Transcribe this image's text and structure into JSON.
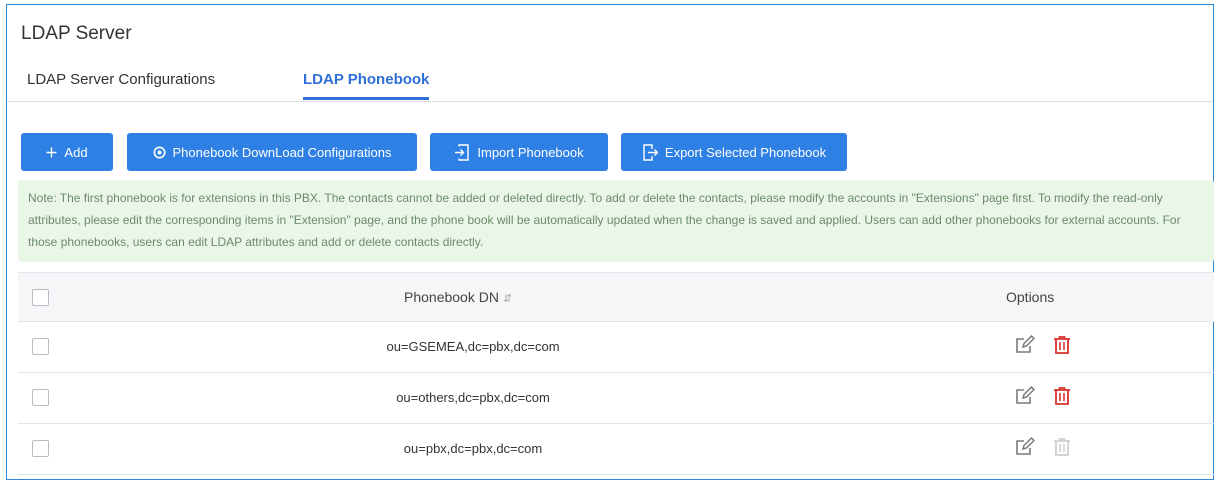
{
  "page": {
    "title": "LDAP Server"
  },
  "tabs": [
    {
      "label": "LDAP Server Configurations",
      "active": false
    },
    {
      "label": "LDAP Phonebook",
      "active": true
    }
  ],
  "toolbar": {
    "add_label": "Add",
    "download_config_label": "Phonebook DownLoad Configurations",
    "import_label": "Import Phonebook",
    "export_label": "Export Selected Phonebook"
  },
  "note": {
    "text": "Note: The first phonebook is for extensions in this PBX. The contacts cannot be added or deleted directly. To add or delete the contacts, please modify the accounts in \"Extensions\" page first. To modify the read-only attributes, please edit the corresponding items in \"Extension\" page, and the phone book will be automatically updated when the change is saved and applied. Users can add other phonebooks for external accounts. For those phonebooks, users can edit LDAP attributes and add or delete contacts directly."
  },
  "table": {
    "columns": {
      "dn": "Phonebook DN",
      "options": "Options"
    },
    "rows": [
      {
        "dn": "ou=GSEMEA,dc=pbx,dc=com",
        "delete_enabled": true
      },
      {
        "dn": "ou=others,dc=pbx,dc=com",
        "delete_enabled": true
      },
      {
        "dn": "ou=pbx,dc=pbx,dc=com",
        "delete_enabled": false
      }
    ]
  },
  "colors": {
    "accent": "#2f80e4",
    "tab_active": "#2f6fd6",
    "delete": "#d9302c",
    "delete_disabled": "#cfcfcf",
    "note_bg": "#e9f6e8",
    "note_text": "#6d8b6a"
  },
  "icons": {
    "add": "plus-icon",
    "download_config": "settings-icon",
    "import": "import-icon",
    "export": "export-icon",
    "edit": "edit-icon",
    "delete": "trash-icon",
    "sort": "sort-icon"
  }
}
